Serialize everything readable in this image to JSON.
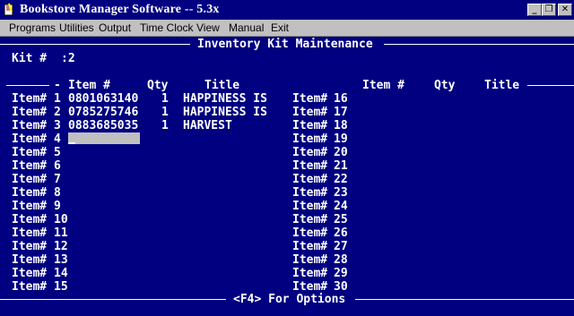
{
  "window": {
    "title": "Bookstore Manager Software -- 5.3x",
    "controls": {
      "minimize": "_",
      "restore": "❐",
      "close": "✕"
    }
  },
  "menu": [
    "Programs",
    "Utilities",
    "Output",
    "Time Clock",
    "View",
    "Manual",
    "Exit"
  ],
  "screen": {
    "title": "Inventory Kit Maintenance",
    "kit_label": "Kit #",
    "kit_value": ":2",
    "dash": "-",
    "headers": {
      "item": "Item #",
      "qty": "Qty",
      "title": "Title"
    },
    "footer": "<F4> For Options",
    "left_rows": [
      {
        "label": "Item#",
        "num": "1",
        "item": "0801063140",
        "qty": "1",
        "title": "HAPPINESS IS"
      },
      {
        "label": "Item#",
        "num": "2",
        "item": "0785275746",
        "qty": "1",
        "title": "HAPPINESS IS"
      },
      {
        "label": "Item#",
        "num": "3",
        "item": "0883685035",
        "qty": "1",
        "title": "HARVEST"
      },
      {
        "label": "Item#",
        "num": "4",
        "item": "",
        "qty": "",
        "title": ""
      },
      {
        "label": "Item#",
        "num": "5",
        "item": "",
        "qty": "",
        "title": ""
      },
      {
        "label": "Item#",
        "num": "6",
        "item": "",
        "qty": "",
        "title": ""
      },
      {
        "label": "Item#",
        "num": "7",
        "item": "",
        "qty": "",
        "title": ""
      },
      {
        "label": "Item#",
        "num": "8",
        "item": "",
        "qty": "",
        "title": ""
      },
      {
        "label": "Item#",
        "num": "9",
        "item": "",
        "qty": "",
        "title": ""
      },
      {
        "label": "Item#",
        "num": "10",
        "item": "",
        "qty": "",
        "title": ""
      },
      {
        "label": "Item#",
        "num": "11",
        "item": "",
        "qty": "",
        "title": ""
      },
      {
        "label": "Item#",
        "num": "12",
        "item": "",
        "qty": "",
        "title": ""
      },
      {
        "label": "Item#",
        "num": "13",
        "item": "",
        "qty": "",
        "title": ""
      },
      {
        "label": "Item#",
        "num": "14",
        "item": "",
        "qty": "",
        "title": ""
      },
      {
        "label": "Item#",
        "num": "15",
        "item": "",
        "qty": "",
        "title": ""
      }
    ],
    "right_rows": [
      {
        "label": "Item#",
        "num": "16"
      },
      {
        "label": "Item#",
        "num": "17"
      },
      {
        "label": "Item#",
        "num": "18"
      },
      {
        "label": "Item#",
        "num": "19"
      },
      {
        "label": "Item#",
        "num": "20"
      },
      {
        "label": "Item#",
        "num": "21"
      },
      {
        "label": "Item#",
        "num": "22"
      },
      {
        "label": "Item#",
        "num": "23"
      },
      {
        "label": "Item#",
        "num": "24"
      },
      {
        "label": "Item#",
        "num": "25"
      },
      {
        "label": "Item#",
        "num": "26"
      },
      {
        "label": "Item#",
        "num": "27"
      },
      {
        "label": "Item#",
        "num": "28"
      },
      {
        "label": "Item#",
        "num": "29"
      },
      {
        "label": "Item#",
        "num": "30"
      }
    ]
  },
  "colors": {
    "screen_bg": "#000080",
    "text": "#ffffff",
    "input_highlight": "#c0c0c0"
  }
}
